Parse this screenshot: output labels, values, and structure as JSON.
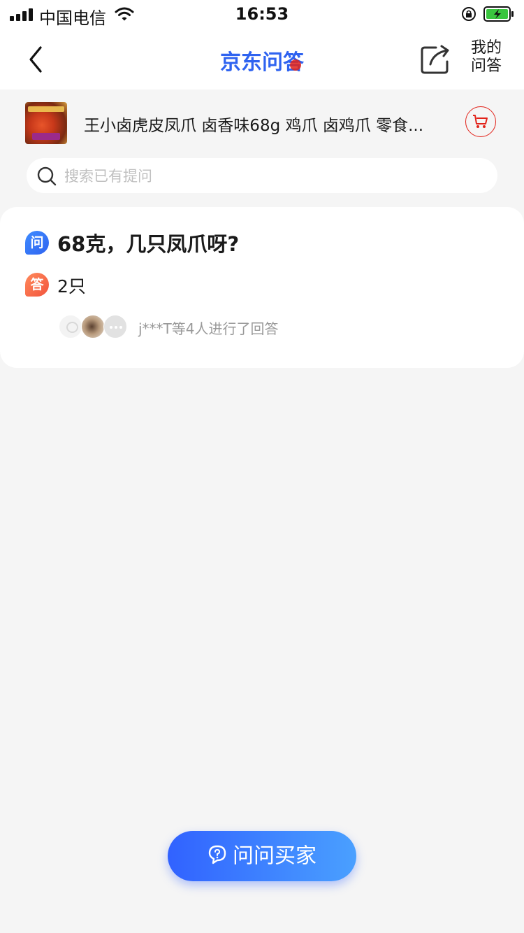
{
  "status_bar": {
    "carrier": "中国电信",
    "time": "16:53"
  },
  "nav": {
    "logo_text": "京东问答",
    "my_qa_line1": "我的",
    "my_qa_line2": "问答"
  },
  "product": {
    "title": "王小卤虎皮凤爪 卤香味68g 鸡爪 卤鸡爪 零食..."
  },
  "search": {
    "placeholder": "搜索已有提问",
    "value": ""
  },
  "qa": {
    "question_badge": "问",
    "question": "68克，几只凤爪呀?",
    "answer_badge": "答",
    "answer": "2只",
    "answered_summary": "j***T等4人进行了回答"
  },
  "ask_button": {
    "label": "问问买家"
  },
  "icons": {
    "back": "chevron-left-icon",
    "share": "share-icon",
    "cart": "cart-icon",
    "search": "search-icon",
    "ask": "chat-question-icon"
  },
  "colors": {
    "brand_red": "#e2231a",
    "brand_blue": "#2f63f0",
    "answer_orange": "#f2543d",
    "background": "#f5f5f5"
  }
}
